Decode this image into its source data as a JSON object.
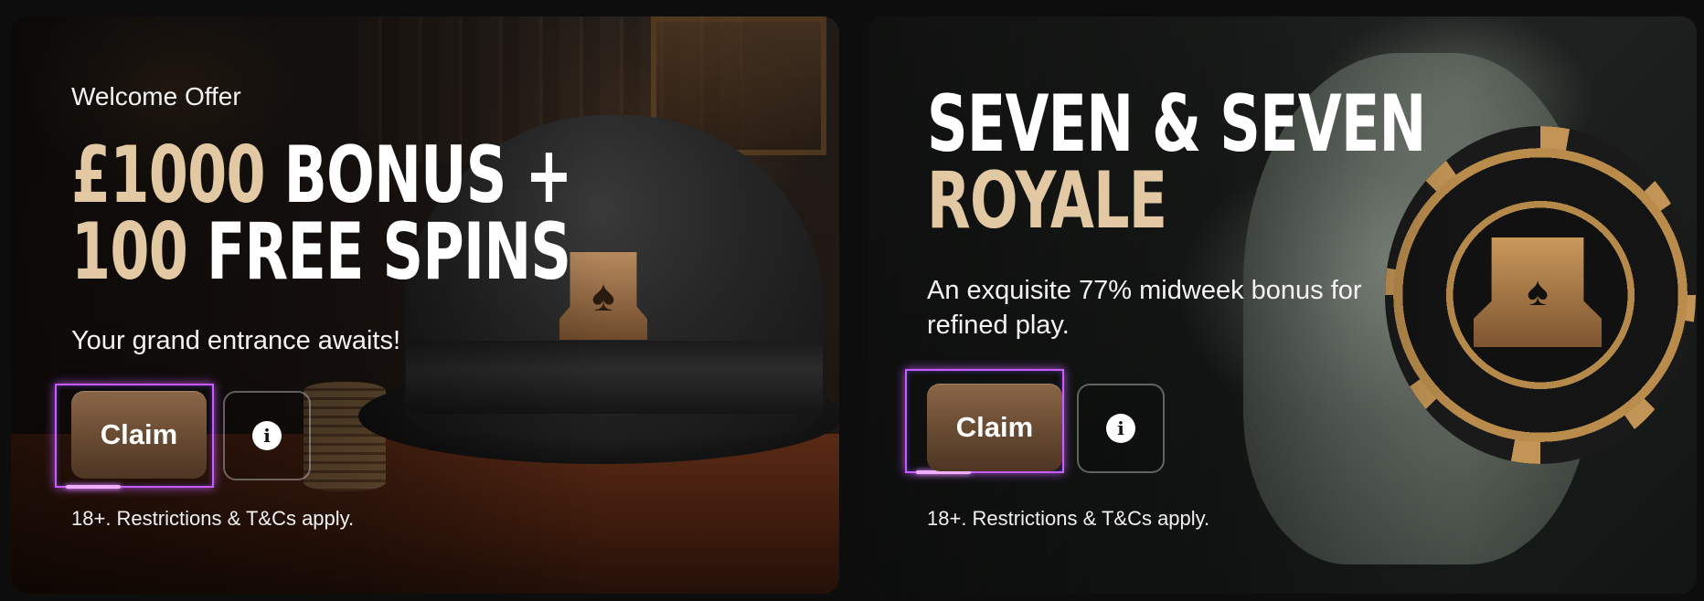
{
  "offers": [
    {
      "kicker": "Welcome Offer",
      "headline_line1_gold": "£1000",
      "headline_line1_white": "BONUS +",
      "headline_line2_gold": "100",
      "headline_line2_white": "FREE SPINS",
      "subtext": "Your grand entrance awaits!",
      "claim_label": "Claim",
      "info_icon": "i",
      "terms": "18+. Restrictions & T&Cs apply."
    },
    {
      "headline_line1_white": "SEVEN & SEVEN",
      "headline_line2_gold": "ROYALE",
      "subtext": "An exquisite 77% midweek bonus for refined play.",
      "claim_label": "Claim",
      "info_icon": "i",
      "terms": "18+. Restrictions & T&Cs apply."
    }
  ],
  "icons": {
    "info": "info-icon",
    "emblem": "spade-top-hat-icon"
  },
  "colors": {
    "gold_text": "#e3c9a3",
    "claim_button": "#6a4c33",
    "focus_ring": "#c85cff"
  }
}
